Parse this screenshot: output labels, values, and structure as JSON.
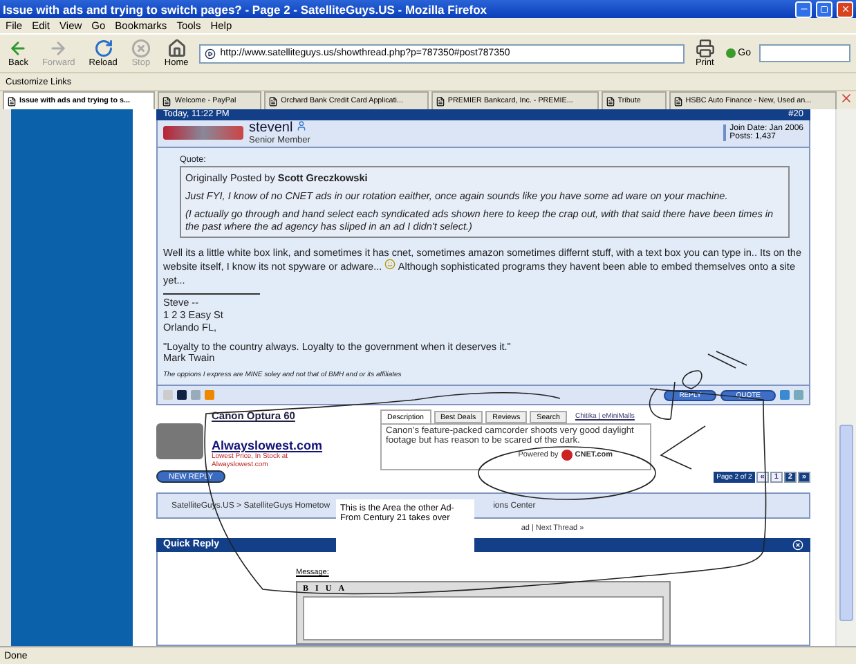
{
  "window": {
    "title": "Issue with ads and trying to switch pages? - Page 2 - SatelliteGuys.US - Mozilla Firefox"
  },
  "menu": [
    "File",
    "Edit",
    "View",
    "Go",
    "Bookmarks",
    "Tools",
    "Help"
  ],
  "toolbar": {
    "buttons": [
      {
        "label": "Back",
        "disabled": false
      },
      {
        "label": "Forward",
        "disabled": true
      },
      {
        "label": "Reload",
        "disabled": false
      },
      {
        "label": "Stop",
        "disabled": true
      },
      {
        "label": "Home",
        "disabled": false
      }
    ],
    "url": "http://www.satelliteguys.us/showthread.php?p=787350#post787350",
    "print": "Print",
    "go": "Go"
  },
  "bookmarks": [
    "Customize Links"
  ],
  "tabs": [
    {
      "label": "Issue with ads and trying to s...",
      "selected": true
    },
    {
      "label": "Welcome - PayPal",
      "selected": false
    },
    {
      "label": "Orchard Bank Credit Card Applicati...",
      "selected": false
    },
    {
      "label": "PREMIER Bankcard, Inc. - PREMIE...",
      "selected": false
    },
    {
      "label": "Tribute",
      "selected": false
    },
    {
      "label": "HSBC Auto Finance - New, Used an...",
      "selected": false
    }
  ],
  "post": {
    "date": "Today, 11:22 PM",
    "number": "#20",
    "username": "stevenl",
    "user_title": "Senior Member",
    "join_date": "Join Date: Jan 2006",
    "posts": "Posts: 1,437",
    "quote_label": "Quote:",
    "quote_author": "Originally Posted by **Scott Greczkowski**",
    "quote_lines": [
      "Just FYI, I know of no CNET ads in our rotation eaither, once again sounds like you have some ad ware on your machine.",
      "(I actually go through and hand select each syndicated ads shown here to keep the crap out, with that said there have been times in the past where the ad agency has sliped in an ad I didn't select.)"
    ],
    "message_start": "Well its a little white box link, and sometimes it has cnet, sometimes amazon sometimes differnt stuff, with a text box you can type in.. Its on the website itself, I know its not spyware or adware...",
    "message_end": "Although sophisticated programs they havent been able to embed themselves onto a site yet...",
    "signature": [
      "Steve --",
      "1 2 3 Easy St",
      "Orlando FL,"
    ],
    "signature_quote": [
      "\"Loyalty to the country always. Loyalty to the government when it deserves it.\"",
      "Mark Twain"
    ],
    "disclaimer": "The oppions I express are MINE soley and not that of BMH and or its affiliates",
    "buttons": [
      "REPLY",
      "QUOTE"
    ]
  },
  "ad": {
    "product": "Canon Optura 60",
    "store": "Alwayslowest.com",
    "store_note": "Lowest Price, In Stock at Alwayslowest.com",
    "tabs": [
      {
        "label": "Description",
        "selected": true
      },
      {
        "label": "Best Deals",
        "selected": false
      },
      {
        "label": "Reviews",
        "selected": false
      },
      {
        "label": "Search",
        "selected": false
      }
    ],
    "link": "Chitika | eMiniMalls",
    "description": "Canon's feature-packed camcorder shoots very good daylight footage but has reason to be scared of the dark.",
    "powered_by": "Powered by",
    "logo": "CNET.com"
  },
  "new_reply": "NEW REPLY",
  "pagination": {
    "label": "Page 2 of 2",
    "first": "«",
    "pages": [
      {
        "label": "1",
        "selected": false
      },
      {
        "label": "2",
        "selected": true
      }
    ],
    "next": "»"
  },
  "note": "This is the Area the other Ad- From Century 21 takes over",
  "breadcrumb": [
    "SatelliteGuys.US > SatelliteGuys Hometow",
    "ions Center"
  ],
  "thread_nav": "ad | Next Thread »",
  "quick_reply": {
    "title": "Quick Reply",
    "message_label": "Message:",
    "format_buttons": [
      "B",
      "I",
      "U",
      "A"
    ]
  },
  "status_bar": "Done"
}
